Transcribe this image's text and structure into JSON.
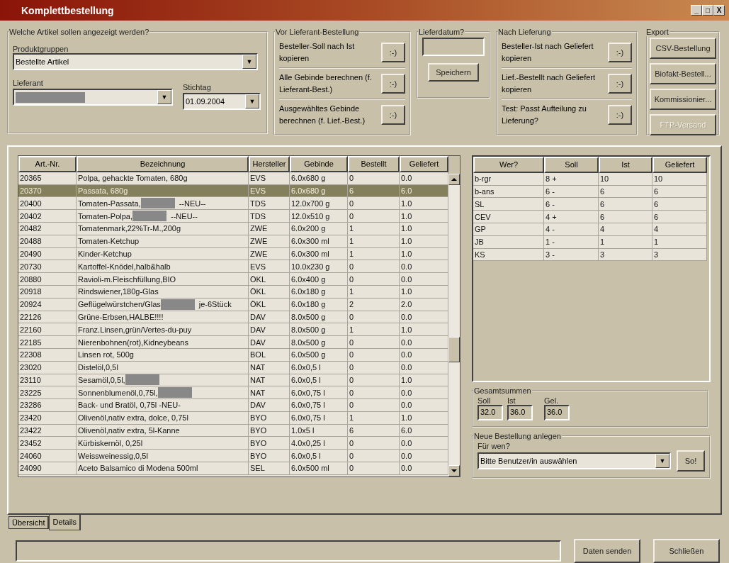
{
  "window": {
    "title": "Komplettbestellung",
    "controls": [
      "_",
      "□",
      "X"
    ]
  },
  "filter": {
    "legend": "Welche Artikel sollen angezeigt werden?",
    "group_label": "Produktgruppen",
    "group_value": "Bestellte Artikel",
    "supplier_label": "Lieferant",
    "supplier_redacted": true,
    "date_label": "Stichtag",
    "date_value": "01.09.2004",
    "dropdown_glyph": "▼"
  },
  "before": {
    "legend": "Vor Lieferant-Bestellung",
    "actions": [
      {
        "text": "Besteller-Soll nach Ist kopieren",
        "button": ":-)"
      },
      {
        "text": "Alle Gebinde berechnen (f. Lieferant-Best.)",
        "button": ":-)"
      },
      {
        "text": "Ausgewähltes Gebinde berechnen (f. Lief.-Best.)",
        "button": ":-)"
      }
    ]
  },
  "delivery_date": {
    "legend": "Lieferdatum?",
    "button": "Speichern"
  },
  "after": {
    "legend": "Nach Lieferung",
    "actions": [
      {
        "text": "Besteller-Ist nach Geliefert kopieren",
        "button": ":-)"
      },
      {
        "text": "Lief.-Bestellt nach Geliefert kopieren",
        "button": ":-)"
      },
      {
        "text": "Test: Passt Aufteilung zu Lieferung?",
        "button": ":-)"
      }
    ]
  },
  "export": {
    "legend": "Export",
    "buttons": [
      {
        "label": "CSV-Bestellung",
        "disabled": false
      },
      {
        "label": "Biofakt-Bestell...",
        "disabled": false
      },
      {
        "label": "Kommissionier...",
        "disabled": false
      },
      {
        "label": "FTP-Versand",
        "disabled": true
      }
    ]
  },
  "articles": {
    "columns": [
      "Art.-Nr.",
      "Bezeichnung",
      "Hersteller",
      "Gebinde",
      "Bestellt",
      "Geliefert"
    ],
    "rows": [
      {
        "nr": "20365",
        "name": "Polpa, gehackte Tomaten, 680g",
        "redacted": false,
        "maker": "EVS",
        "pack": "6.0x680 g",
        "ordered": "0",
        "delivered": "0.0",
        "selected": false
      },
      {
        "nr": "20370",
        "name": "Passata, 680g",
        "redacted": false,
        "maker": "EVS",
        "pack": "6.0x680 g",
        "ordered": "6",
        "delivered": "6.0",
        "selected": true
      },
      {
        "nr": "20400",
        "name": "Tomaten-Passata,",
        "redacted": true,
        "suffix": "--NEU--",
        "maker": "TDS",
        "pack": "12.0x700 g",
        "ordered": "0",
        "delivered": "1.0",
        "selected": false
      },
      {
        "nr": "20402",
        "name": "Tomaten-Polpa,",
        "redacted": true,
        "suffix": "--NEU--",
        "maker": "TDS",
        "pack": "12.0x510 g",
        "ordered": "0",
        "delivered": "1.0",
        "selected": false
      },
      {
        "nr": "20482",
        "name": "Tomatenmark,22%Tr-M.,200g",
        "redacted": false,
        "maker": "ZWE",
        "pack": "6.0x200 g",
        "ordered": "1",
        "delivered": "1.0",
        "selected": false
      },
      {
        "nr": "20488",
        "name": "Tomaten-Ketchup",
        "redacted": false,
        "maker": "ZWE",
        "pack": "6.0x300 ml",
        "ordered": "1",
        "delivered": "1.0",
        "selected": false
      },
      {
        "nr": "20490",
        "name": "Kinder-Ketchup",
        "redacted": false,
        "maker": "ZWE",
        "pack": "6.0x300 ml",
        "ordered": "1",
        "delivered": "1.0",
        "selected": false
      },
      {
        "nr": "20730",
        "name": "Kartoffel-Knödel,halb&halb",
        "redacted": false,
        "maker": "EVS",
        "pack": "10.0x230 g",
        "ordered": "0",
        "delivered": "0.0",
        "selected": false
      },
      {
        "nr": "20880",
        "name": "Ravioli-m.Fleischfüllung,BIO",
        "redacted": false,
        "maker": "ÖKL",
        "pack": "6.0x400 g",
        "ordered": "0",
        "delivered": "0.0",
        "selected": false
      },
      {
        "nr": "20918",
        "name": "Rindswiener,180g-Glas",
        "redacted": false,
        "maker": "ÖKL",
        "pack": "6.0x180 g",
        "ordered": "1",
        "delivered": "1.0",
        "selected": false
      },
      {
        "nr": "20924",
        "name": "Geflügelwürstchen/Glas",
        "redacted": true,
        "suffix": "je-6Stück",
        "maker": "ÖKL",
        "pack": "6.0x180 g",
        "ordered": "2",
        "delivered": "2.0",
        "selected": false
      },
      {
        "nr": "22126",
        "name": "Grüne-Erbsen,HALBE!!!!",
        "redacted": false,
        "maker": "DAV",
        "pack": "8.0x500 g",
        "ordered": "0",
        "delivered": "0.0",
        "selected": false
      },
      {
        "nr": "22160",
        "name": "Franz.Linsen,grün/Vertes-du-puy",
        "redacted": false,
        "maker": "DAV",
        "pack": "8.0x500 g",
        "ordered": "1",
        "delivered": "1.0",
        "selected": false
      },
      {
        "nr": "22185",
        "name": "Nierenbohnen(rot),Kidneybeans",
        "redacted": false,
        "maker": "DAV",
        "pack": "8.0x500 g",
        "ordered": "0",
        "delivered": "0.0",
        "selected": false
      },
      {
        "nr": "22308",
        "name": "Linsen rot, 500g",
        "redacted": false,
        "maker": "BOL",
        "pack": "6.0x500 g",
        "ordered": "0",
        "delivered": "0.0",
        "selected": false
      },
      {
        "nr": "23020",
        "name": "Distelöl,0,5l",
        "redacted": false,
        "maker": "NAT",
        "pack": "6.0x0,5 l",
        "ordered": "0",
        "delivered": "0.0",
        "selected": false
      },
      {
        "nr": "23110",
        "name": "Sesamöl,0,5l,",
        "redacted": true,
        "maker": "NAT",
        "pack": "6.0x0,5 l",
        "ordered": "0",
        "delivered": "1.0",
        "selected": false
      },
      {
        "nr": "23225",
        "name": "Sonnenblumenöl,0,75l,",
        "redacted": true,
        "maker": "NAT",
        "pack": "6.0x0,75 l",
        "ordered": "0",
        "delivered": "0.0",
        "selected": false
      },
      {
        "nr": "23286",
        "name": "Back- und Bratöl, 0,75l  -NEU-",
        "redacted": false,
        "maker": "DAV",
        "pack": "6.0x0,75 l",
        "ordered": "0",
        "delivered": "0.0",
        "selected": false
      },
      {
        "nr": "23420",
        "name": "Olivenöl,nativ extra, dolce, 0,75l",
        "redacted": false,
        "maker": "BYO",
        "pack": "6.0x0,75 l",
        "ordered": "1",
        "delivered": "1.0",
        "selected": false
      },
      {
        "nr": "23422",
        "name": "Olivenöl,nativ extra, 5l-Kanne",
        "redacted": false,
        "maker": "BYO",
        "pack": "1.0x5 l",
        "ordered": "6",
        "delivered": "6.0",
        "selected": false
      },
      {
        "nr": "23452",
        "name": "Kürbiskernöl, 0,25l",
        "redacted": false,
        "maker": "BYO",
        "pack": "4.0x0,25 l",
        "ordered": "0",
        "delivered": "0.0",
        "selected": false
      },
      {
        "nr": "24060",
        "name": "Weissweinessig,0,5l",
        "redacted": false,
        "maker": "BYO",
        "pack": "6.0x0,5 l",
        "ordered": "0",
        "delivered": "0.0",
        "selected": false
      },
      {
        "nr": "24090",
        "name": "Aceto Balsamico di Modena 500ml",
        "redacted": false,
        "maker": "SEL",
        "pack": "6.0x500 ml",
        "ordered": "0",
        "delivered": "0.0",
        "selected": false
      }
    ]
  },
  "split": {
    "columns": [
      "Wer?",
      "Soll",
      "Ist",
      "Geliefert"
    ],
    "rows": [
      [
        "b-rgr",
        "8 +",
        "10",
        "10"
      ],
      [
        "b-ans",
        "6 -",
        "6",
        "6"
      ],
      [
        "SL",
        "6 -",
        "6",
        "6"
      ],
      [
        "CEV",
        "4 +",
        "6",
        "6"
      ],
      [
        "GP",
        "4 -",
        "4",
        "4"
      ],
      [
        "JB",
        "1 -",
        "1",
        "1"
      ],
      [
        "KS",
        "3 -",
        "3",
        "3"
      ]
    ]
  },
  "totals": {
    "legend": "Gesamtsummen",
    "fields": [
      {
        "label": "Soll",
        "value": "32.0"
      },
      {
        "label": "Ist",
        "value": "36.0"
      },
      {
        "label": "Gel.",
        "value": "36.0"
      }
    ]
  },
  "new_order": {
    "legend": "Neue Bestellung anlegen",
    "label": "Für wen?",
    "value": "Bitte Benutzer/in auswählen",
    "button": "So!"
  },
  "tabs": [
    {
      "label": "Übersicht",
      "selected": false
    },
    {
      "label": "Details",
      "selected": true
    }
  ],
  "footer": {
    "buttons": [
      "Daten senden",
      "Schließen"
    ]
  }
}
